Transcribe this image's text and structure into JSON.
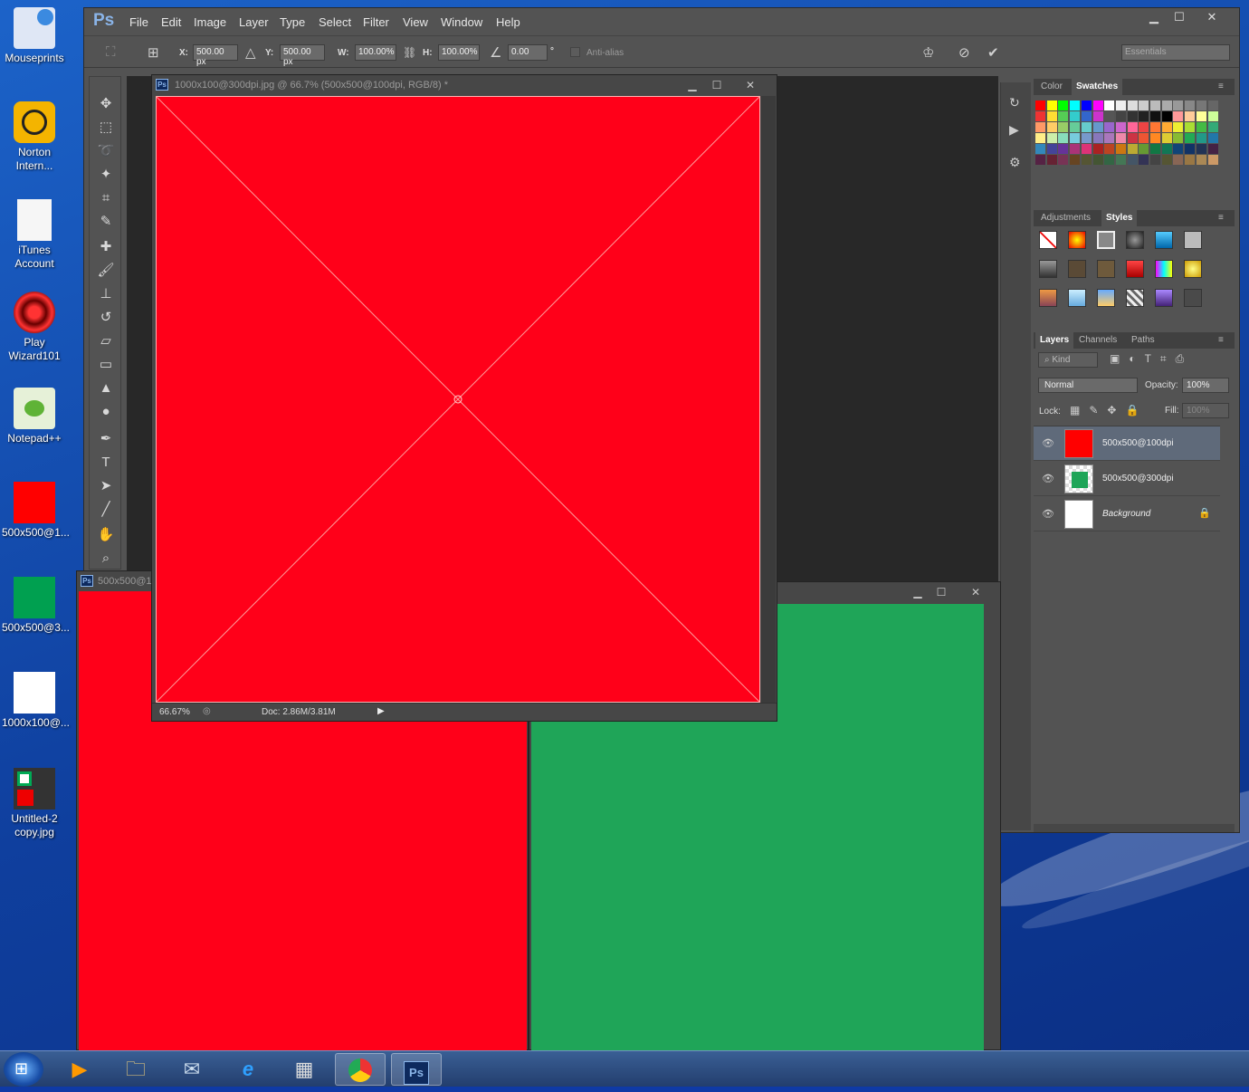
{
  "desktop": {
    "icons": [
      {
        "label": "Mouseprints"
      },
      {
        "label": "Norton Intern..."
      },
      {
        "label": "iTunes Account"
      },
      {
        "label": "Play Wizard101"
      },
      {
        "label": "Notepad++"
      },
      {
        "label": "500x500@1...",
        "color": "#ff0000"
      },
      {
        "label": "500x500@3...",
        "color": "#00a050"
      },
      {
        "label": "1000x100@...",
        "color": "#ffffff"
      },
      {
        "label": "Untitled-2 copy.jpg"
      }
    ]
  },
  "ps": {
    "logo": "Ps",
    "menus": [
      "File",
      "Edit",
      "Image",
      "Layer",
      "Type",
      "Select",
      "Filter",
      "View",
      "Window",
      "Help"
    ],
    "options": {
      "x_label": "X:",
      "x_value": "500.00 px",
      "y_label": "Y:",
      "y_value": "500.00 px",
      "w_label": "W:",
      "w_value": "100.00%",
      "h_label": "H:",
      "h_value": "100.00%",
      "angle_value": "0.00",
      "degree": "°",
      "antialias": "Anti-alias",
      "workspace": "Essentials"
    },
    "doc_main": {
      "title": "1000x100@300dpi.jpg @ 66.7% (500x500@100dpi, RGB/8) *",
      "zoom": "66.67%",
      "doc_info": "Doc: 2.86M/3.81M",
      "canvas_color": "#ff0019"
    },
    "doc_back": {
      "title": "500x500@1",
      "canvas_color": "#ff0019"
    },
    "doc_green": {
      "canvas_color": "#1fa558"
    },
    "panels": {
      "color_tab": "Color",
      "swatches_tab": "Swatches",
      "adjustments_tab": "Adjustments",
      "styles_tab": "Styles",
      "layers_tab": "Layers",
      "channels_tab": "Channels",
      "paths_tab": "Paths",
      "kind": "Kind",
      "blend_mode": "Normal",
      "opacity_label": "Opacity:",
      "opacity_value": "100%",
      "lock_label": "Lock:",
      "fill_label": "Fill:",
      "fill_value": "100%",
      "layers": [
        {
          "name": "500x500@100dpi",
          "color": "#ff0000"
        },
        {
          "name": "500x500@300dpi",
          "color": "#1fa558"
        },
        {
          "name": "Background",
          "color": "#ffffff"
        }
      ]
    }
  },
  "taskbar": {
    "items": [
      "windows-media-player",
      "explorer",
      "thunderbird",
      "internet-explorer",
      "calculator",
      "chrome",
      "photoshop"
    ]
  }
}
